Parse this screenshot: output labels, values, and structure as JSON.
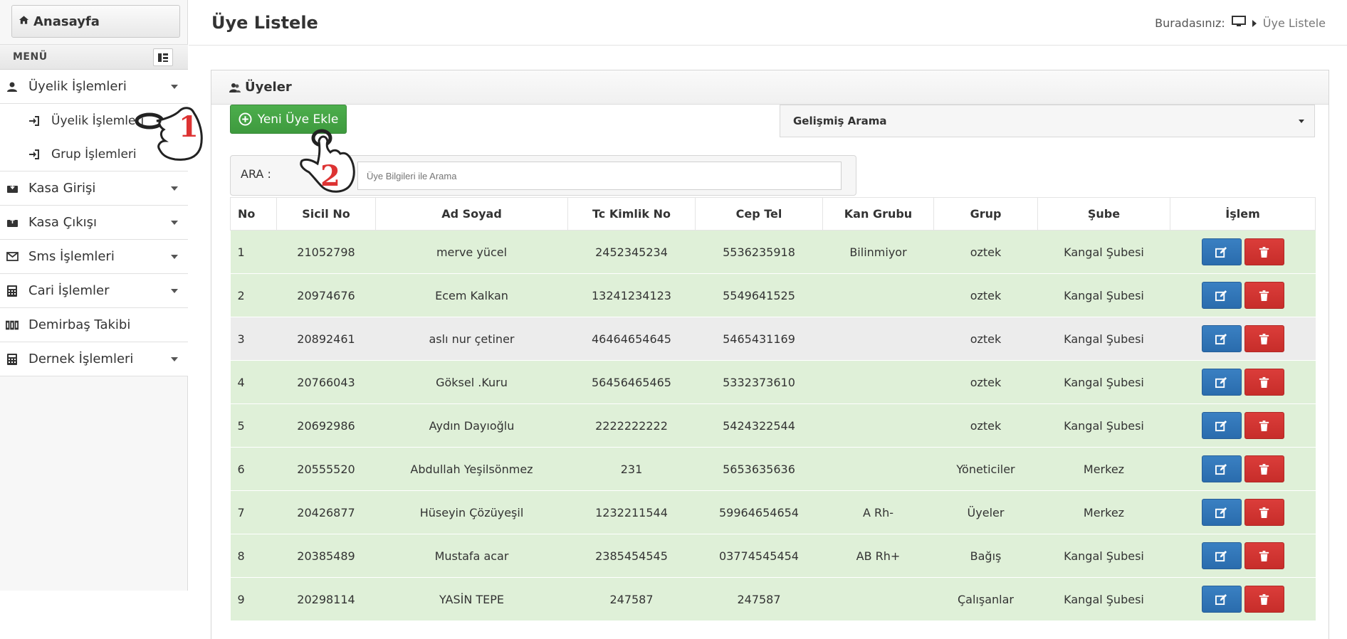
{
  "sidebar": {
    "home_label": "Anasayfa",
    "menu_label": "MENÜ",
    "items": [
      {
        "label": "Üyelik İşlemleri",
        "icon": "user-icon",
        "children": [
          {
            "label": "Üyelik İşlemleri",
            "icon": "sign-in-icon"
          },
          {
            "label": "Grup İşlemleri",
            "icon": "sign-in-icon"
          }
        ]
      },
      {
        "label": "Kasa Girişi",
        "icon": "inbox-in-icon"
      },
      {
        "label": "Kasa Çıkışı",
        "icon": "inbox-out-icon"
      },
      {
        "label": "Sms İşlemleri",
        "icon": "envelope-icon"
      },
      {
        "label": "Cari İşlemler",
        "icon": "calculator-icon"
      },
      {
        "label": "Demirbaş Takibi",
        "icon": "barcode-icon"
      },
      {
        "label": "Dernek İşlemleri",
        "icon": "calculator-icon"
      }
    ]
  },
  "header": {
    "title": "Üye Listele",
    "breadcrumb_prefix": "Buradasınız:",
    "breadcrumb_current": "Üye Listele"
  },
  "panel": {
    "title": "Üyeler",
    "add_button": "Yeni Üye Ekle",
    "advanced_search": "Gelişmiş Arama",
    "search_label": "ARA :",
    "search_placeholder": "Üye Bilgileri ile Arama"
  },
  "table": {
    "headers": [
      "No",
      "Sicil No",
      "Ad Soyad",
      "Tc Kimlik No",
      "Cep Tel",
      "Kan Grubu",
      "Grup",
      "Şube",
      "İşlem"
    ],
    "rows": [
      [
        "1",
        "21052798",
        "merve yücel",
        "2452345234",
        "5536235918",
        "Bilinmiyor",
        "oztek",
        "Kangal Şubesi"
      ],
      [
        "2",
        "20974676",
        "Ecem Kalkan",
        "13241234123",
        "5549641525",
        "",
        "oztek",
        "Kangal Şubesi"
      ],
      [
        "3",
        "20892461",
        "aslı nur çetiner",
        "46464654645",
        "5465431169",
        "",
        "oztek",
        "Kangal Şubesi"
      ],
      [
        "4",
        "20766043",
        "Göksel .Kuru",
        "56456465465",
        "5332373610",
        "",
        "oztek",
        "Kangal Şubesi"
      ],
      [
        "5",
        "20692986",
        "Aydın Dayıoğlu",
        "2222222222",
        "5424322544",
        "",
        "oztek",
        "Kangal Şubesi"
      ],
      [
        "6",
        "20555520",
        "Abdullah Yeşilsönmez",
        "231",
        "5653635636",
        "",
        "Yöneticiler",
        "Merkez"
      ],
      [
        "7",
        "20426877",
        "Hüseyin Çözüyeşil",
        "1232211544",
        "59964654654",
        "A Rh-",
        "Üyeler",
        "Merkez"
      ],
      [
        "8",
        "20385489",
        "Mustafa acar",
        "2385454545",
        "03774545454",
        "AB Rh+",
        "Bağış",
        "Kangal Şubesi"
      ],
      [
        "9",
        "20298114",
        "YASİN TEPE",
        "247587",
        "247587",
        "",
        "Çalışanlar",
        "Kangal Şubesi"
      ]
    ]
  },
  "annotations": {
    "step1": "1",
    "step2": "2"
  },
  "colors": {
    "row_green": "#dff0d8",
    "row_gray": "#ececec",
    "edit_blue": "#2a6cad",
    "delete_red": "#c72d2a",
    "add_green": "#449d44"
  }
}
